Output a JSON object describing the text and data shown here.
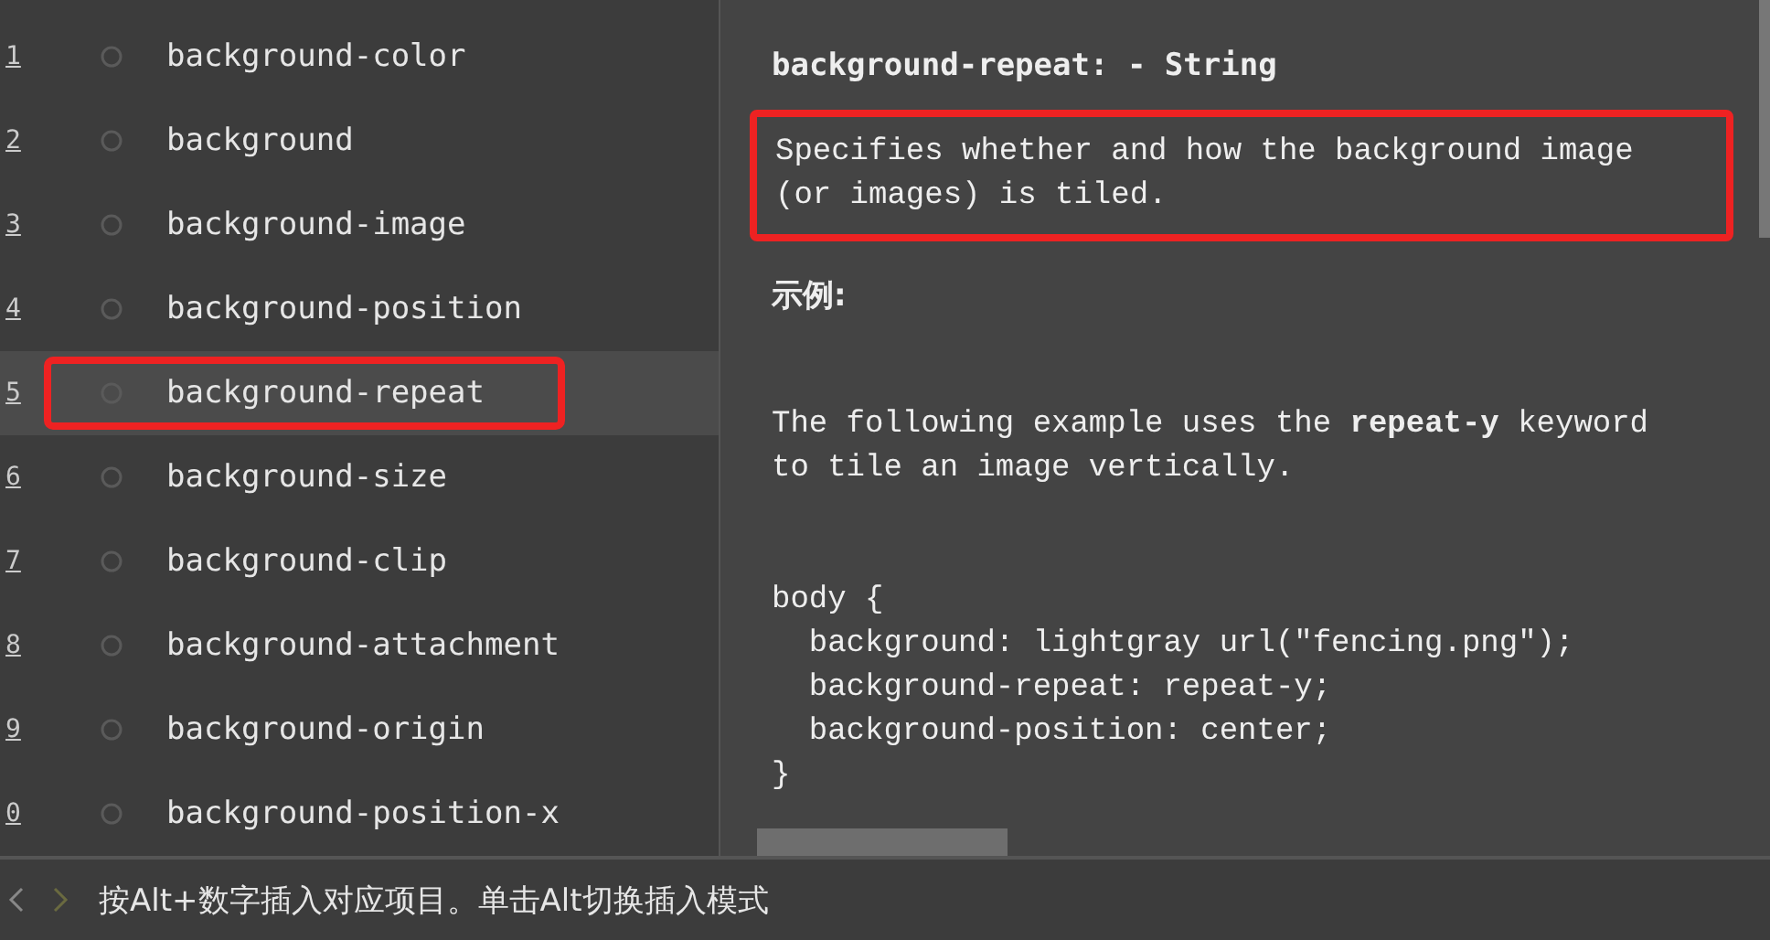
{
  "suggestions": [
    {
      "number": "1",
      "label": "background-color",
      "selected": false
    },
    {
      "number": "2",
      "label": "background",
      "selected": false
    },
    {
      "number": "3",
      "label": "background-image",
      "selected": false
    },
    {
      "number": "4",
      "label": "background-position",
      "selected": false
    },
    {
      "number": "5",
      "label": "background-repeat",
      "selected": true
    },
    {
      "number": "6",
      "label": "background-size",
      "selected": false
    },
    {
      "number": "7",
      "label": "background-clip",
      "selected": false
    },
    {
      "number": "8",
      "label": "background-attachment",
      "selected": false
    },
    {
      "number": "9",
      "label": "background-origin",
      "selected": false
    },
    {
      "number": "0",
      "label": "background-position-x",
      "selected": false
    }
  ],
  "doc": {
    "title": "background-repeat: - String",
    "description": {
      "text": "Specifies whether and how the background image (or images) is tiled.",
      "highlighted": true
    },
    "example_heading": "示例:",
    "example_text": "The following example uses the **repeat-y** keyword to tile an image vertically.",
    "code": [
      "body {",
      "  background: lightgray url(\"fencing.png\");",
      "  background-repeat: repeat-y;",
      "  background-position: center;",
      "}"
    ]
  },
  "status_bar": {
    "hint": "按Alt+数字插入对应项目。单击Alt切换插入模式"
  }
}
